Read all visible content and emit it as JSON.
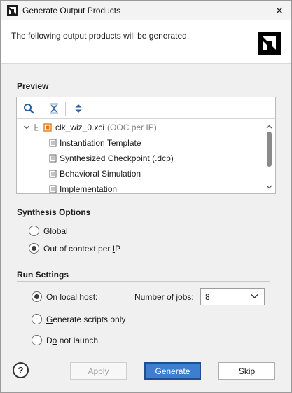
{
  "window": {
    "title": "Generate Output Products",
    "close_glyph": "✕"
  },
  "header": {
    "description": "The following output products will be generated."
  },
  "preview": {
    "title": "Preview",
    "toolbar": {
      "search": "search-icon",
      "collapse": "collapse-all-icon",
      "expand": "expand-all-icon"
    },
    "tree": {
      "root": {
        "name": "clk_wiz_0.xci",
        "suffix": "(OOC per IP)"
      },
      "children": [
        "Instantiation Template",
        "Synthesized Checkpoint (.dcp)",
        "Behavioral Simulation",
        "Implementation"
      ]
    }
  },
  "synthesis": {
    "title": "Synthesis Options",
    "global": {
      "before": "Glo",
      "u": "b",
      "after": "al"
    },
    "ooc": {
      "before": "Out of context per ",
      "u": "I",
      "after": "P"
    },
    "selected": "ooc"
  },
  "run": {
    "title": "Run Settings",
    "local": {
      "before": "On ",
      "u": "l",
      "after": "ocal host:"
    },
    "scripts": {
      "before": "",
      "u": "G",
      "after": "enerate scripts only"
    },
    "nolaunch": {
      "before": "D",
      "u": "o",
      "after": " not launch"
    },
    "selected": "local",
    "jobs_label": "Number of jobs:",
    "jobs_value": "8"
  },
  "footer": {
    "help": "?",
    "apply": {
      "before": "",
      "u": "A",
      "after": "pply"
    },
    "generate": {
      "before": "",
      "u": "G",
      "after": "enerate"
    },
    "skip": {
      "before": "",
      "u": "S",
      "after": "kip"
    }
  },
  "colors": {
    "primary": "#3d7fce",
    "brand": "#000000",
    "file_icon": "#e07a14"
  }
}
